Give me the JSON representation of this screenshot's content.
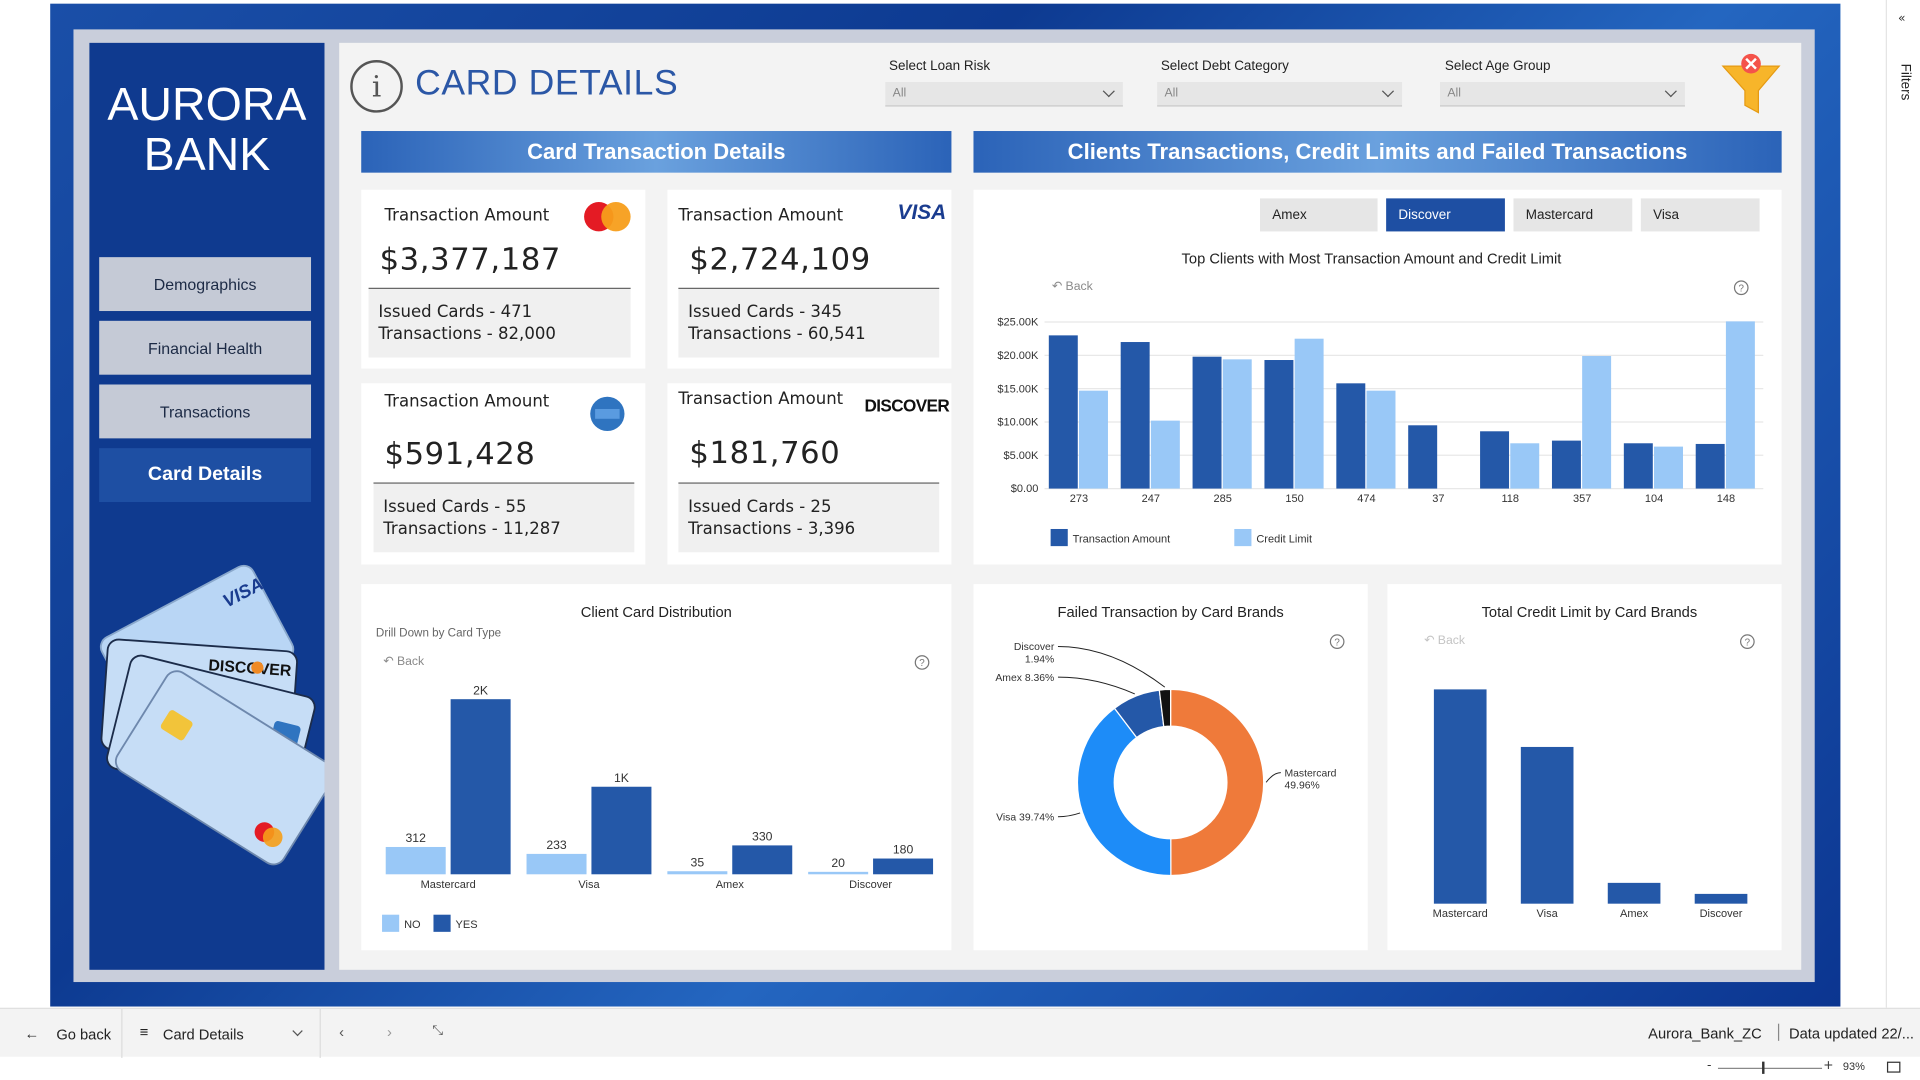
{
  "brand": {
    "line1": "AURORA",
    "line2": "BANK"
  },
  "nav": [
    {
      "label": "Demographics",
      "active": false
    },
    {
      "label": "Financial Health",
      "active": false
    },
    {
      "label": "Transactions",
      "active": false
    },
    {
      "label": "Card Details",
      "active": true
    }
  ],
  "header": {
    "info_glyph": "i",
    "title": "CARD DETAILS"
  },
  "slicers": [
    {
      "label": "Select Loan Risk",
      "value": "All"
    },
    {
      "label": "Select Debt Category",
      "value": "All"
    },
    {
      "label": "Select Age Group",
      "value": "All"
    }
  ],
  "sections": {
    "left": "Card Transaction Details",
    "right": "Clients Transactions, Credit Limits and Failed Transactions"
  },
  "kpis": [
    {
      "label": "Transaction Amount",
      "value": "$3,377,187",
      "issued": "Issued Cards - 471",
      "transactions": "Transactions - 82,000",
      "brand_icon": "mastercard-logo"
    },
    {
      "label": "Transaction Amount",
      "value": "$2,724,109",
      "issued": "Issued Cards - 345",
      "transactions": "Transactions - 60,541",
      "brand_icon": "visa-logo",
      "logo_text": "VISA"
    },
    {
      "label": "Transaction Amount",
      "value": "$591,428",
      "issued": "Issued Cards - 55",
      "transactions": "Transactions - 11,287",
      "brand_icon": "amex-logo"
    },
    {
      "label": "Transaction Amount",
      "value": "$181,760",
      "issued": "Issued Cards - 25",
      "transactions": "Transactions - 3,396",
      "brand_icon": "discover-logo",
      "logo_text": "DISCOVER"
    }
  ],
  "brand_tabs": [
    {
      "label": "Amex",
      "active": false
    },
    {
      "label": "Discover",
      "active": true
    },
    {
      "label": "Mastercard",
      "active": false
    },
    {
      "label": "Visa",
      "active": false
    }
  ],
  "back_label": "Back",
  "help_glyph": "?",
  "card_illustration": {
    "visa": "VISA",
    "discover": "DISCOVER"
  },
  "chart_data": [
    {
      "type": "bar",
      "title": "Top Clients with Most Transaction Amount and Credit Limit",
      "categories": [
        "273",
        "247",
        "285",
        "150",
        "474",
        "37",
        "118",
        "357",
        "104",
        "148"
      ],
      "series": [
        {
          "name": "Transaction Amount",
          "values": [
            23000,
            22000,
            19800,
            19300,
            15800,
            9500,
            8600,
            7200,
            6800,
            6700
          ],
          "color": "#2458a8"
        },
        {
          "name": "Credit Limit",
          "values": [
            14700,
            10200,
            19400,
            22500,
            14700,
            0,
            6800,
            19900,
            6300,
            25100
          ],
          "color": "#99c8f7"
        }
      ],
      "yticks": [
        "$0.00",
        "$5.00K",
        "$10.00K",
        "$15.00K",
        "$20.00K",
        "$25.00K"
      ],
      "ylim": [
        0,
        25000
      ],
      "legend": "bottom-left"
    },
    {
      "type": "bar",
      "title": "Client Card Distribution",
      "subtitle": "Drill Down by Card Type",
      "categories": [
        "Mastercard",
        "Visa",
        "Amex",
        "Discover"
      ],
      "series": [
        {
          "name": "NO",
          "values": [
            312,
            233,
            35,
            20
          ],
          "labels": [
            "312",
            "233",
            "35",
            "20"
          ],
          "color": "#99c8f7"
        },
        {
          "name": "YES",
          "values": [
            2000,
            1000,
            330,
            180
          ],
          "labels": [
            "2K",
            "1K",
            "330",
            "180"
          ],
          "color": "#2458a8"
        }
      ],
      "ylim": [
        0,
        2000
      ],
      "legend": "bottom-left"
    },
    {
      "type": "pie",
      "title": "Failed Transaction by Card Brands",
      "slices": [
        {
          "label": "Mastercard",
          "pct_label": "49.96%",
          "value": 49.96,
          "color": "#ef7a3a"
        },
        {
          "label": "Visa",
          "pct_label": "39.74%",
          "value": 39.74,
          "color": "#1d8cf8"
        },
        {
          "label": "Amex",
          "pct_label": "8.36%",
          "value": 8.36,
          "color": "#2458a8"
        },
        {
          "label": "Discover",
          "pct_label": "1.94%",
          "value": 1.94,
          "color": "#111111"
        }
      ]
    },
    {
      "type": "bar",
      "title": "Total Credit Limit by Card Brands",
      "categories": [
        "Mastercard",
        "Visa",
        "Amex",
        "Discover"
      ],
      "values": [
        175,
        128,
        17,
        8
      ],
      "color": "#2458a8"
    }
  ],
  "bottom": {
    "go_back": "Go back",
    "page_select": "Card Details",
    "file_name": "Aurora_Bank_ZC",
    "data_updated": "Data updated 22/...",
    "zoom": "93%",
    "minus": "-",
    "plus": "+"
  },
  "right_rail": {
    "filters": "Filters"
  },
  "colors": {
    "primary": "#1e4fa3",
    "light_bar": "#99c8f7",
    "dark_bar": "#2458a8",
    "orange": "#ef7a3a",
    "sidebar": "#0f3a8f"
  }
}
